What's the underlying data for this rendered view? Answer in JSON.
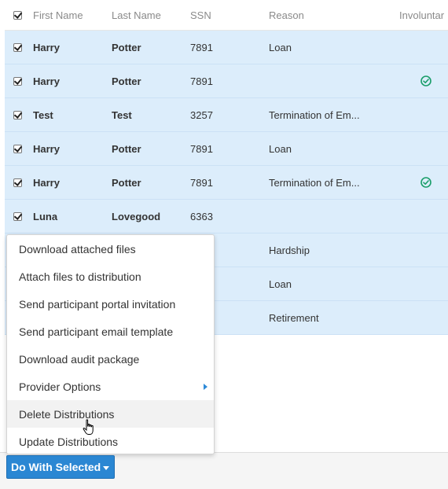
{
  "table": {
    "headers": {
      "first_name": "First Name",
      "last_name": "Last Name",
      "ssn": "SSN",
      "reason": "Reason",
      "involuntary": "Involuntar"
    },
    "rows": [
      {
        "first": "Harry",
        "last": "Potter",
        "ssn": "7891",
        "reason": "Loan",
        "involuntary": false,
        "selected": true
      },
      {
        "first": "Harry",
        "last": "Potter",
        "ssn": "7891",
        "reason": "",
        "involuntary": true,
        "selected": true
      },
      {
        "first": "Test",
        "last": "Test",
        "ssn": "3257",
        "reason": "Termination of Em...",
        "involuntary": false,
        "selected": true
      },
      {
        "first": "Harry",
        "last": "Potter",
        "ssn": "7891",
        "reason": "Loan",
        "involuntary": false,
        "selected": true
      },
      {
        "first": "Harry",
        "last": "Potter",
        "ssn": "7891",
        "reason": "Termination of Em...",
        "involuntary": true,
        "selected": true
      },
      {
        "first": "Luna",
        "last": "Lovegood",
        "ssn": "6363",
        "reason": "",
        "involuntary": false,
        "selected": true
      },
      {
        "first": "",
        "last": "",
        "ssn": "",
        "reason": "Hardship",
        "involuntary": false,
        "selected": true
      },
      {
        "first": "",
        "last": "",
        "ssn": "",
        "reason": "Loan",
        "involuntary": false,
        "selected": true
      },
      {
        "first": "",
        "last": "",
        "ssn": "",
        "reason": "Retirement",
        "involuntary": false,
        "selected": true
      }
    ]
  },
  "menu": {
    "items": [
      {
        "label": "Download attached files"
      },
      {
        "label": "Attach files to distribution"
      },
      {
        "label": "Send participant portal invitation"
      },
      {
        "label": "Send participant email template"
      },
      {
        "label": "Download audit package"
      },
      {
        "label": "Provider Options",
        "submenu": true
      },
      {
        "label": "Delete Distributions",
        "hovered": true
      },
      {
        "label": "Update Distributions"
      }
    ]
  },
  "toolbar": {
    "do_with_selected_label": "Do With Selected"
  },
  "icons": {
    "checkmark": "check-circle-icon",
    "caret": "caret-down-icon",
    "submenu": "caret-right-icon",
    "cursor": "hand-pointer-icon"
  },
  "colors": {
    "row_selected_bg": "#dcedfb",
    "accent": "#2b87d3",
    "success": "#1a9e6a"
  }
}
